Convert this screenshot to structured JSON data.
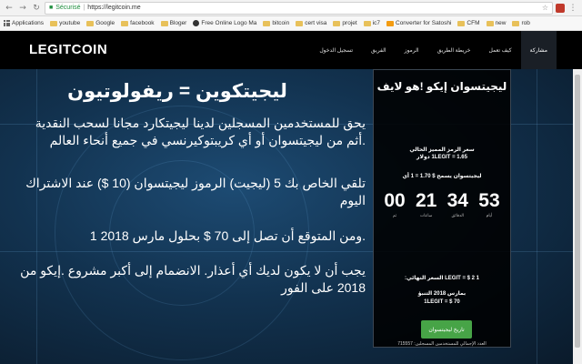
{
  "browser": {
    "secure_label": "Sécurisé",
    "url": "https://legitcoin.me",
    "bookmarks": [
      "Applications",
      "youtube",
      "Google",
      "facebook",
      "Bloger",
      "Free Online Logo Ma",
      "bitcoin",
      "cert visa",
      "projet",
      "ic7",
      "Converter for Satoshi",
      "CFM",
      "new",
      "rob"
    ]
  },
  "site": {
    "logo": "LEGITCOIN",
    "menu": [
      "مشاركة",
      "كيف تعمل",
      "خريطة الطريق",
      "الرموز",
      "الفريق",
      "تسجيل الدخول"
    ],
    "hero": {
      "title": "ليجيتكوين = ريفولوتيون",
      "p1": "يحق للمستخدمين المسجلين لدينا ليجيتكارد مجانا لسحب النقدية .أثم من ليجيتسوان أو أي كريبتوكيرنسي في جميع أنحاء العالم",
      "p2": "تلقي الخاص بك 5 (ليجيت) الرموز ليجيتسوان (10 $) عند الاشتراك اليوم",
      "p3": ".ومن المتوقع أن تصل إلى 70 $ بحلول مارس 2018 1",
      "p4": "يجب أن لا يكون لديك أي أعذار. الانضمام إلى أكبر مشروع .إيكو من 2018 على الفور"
    },
    "panel": {
      "title": "ليجيتسوان إيكو !هو لايف",
      "price_line1": "سعر الرمز المميز الحالي",
      "price_line2": "1LEGIT = 1.65 دولار",
      "rate_line": "ليجيتسوان يسمح $ 1.70 = 1 أي",
      "timer": [
        {
          "value": "53",
          "label": "أيام"
        },
        {
          "value": "34",
          "label": "الدقائق"
        },
        {
          "value": "21",
          "label": "ساعات"
        },
        {
          "value": "00",
          "label": "ثم"
        }
      ],
      "final_price": "1 LEGIT = $ 2 السعر النهائي:",
      "march_line1": "بمارس 2018 التنبؤ",
      "march_line2": "1LEGIT = $ 70",
      "buy_label": "تاريخ ليجيتسوان",
      "registered": "العدد الإجمالي للمستخدمين المسجلين: 715557"
    }
  }
}
